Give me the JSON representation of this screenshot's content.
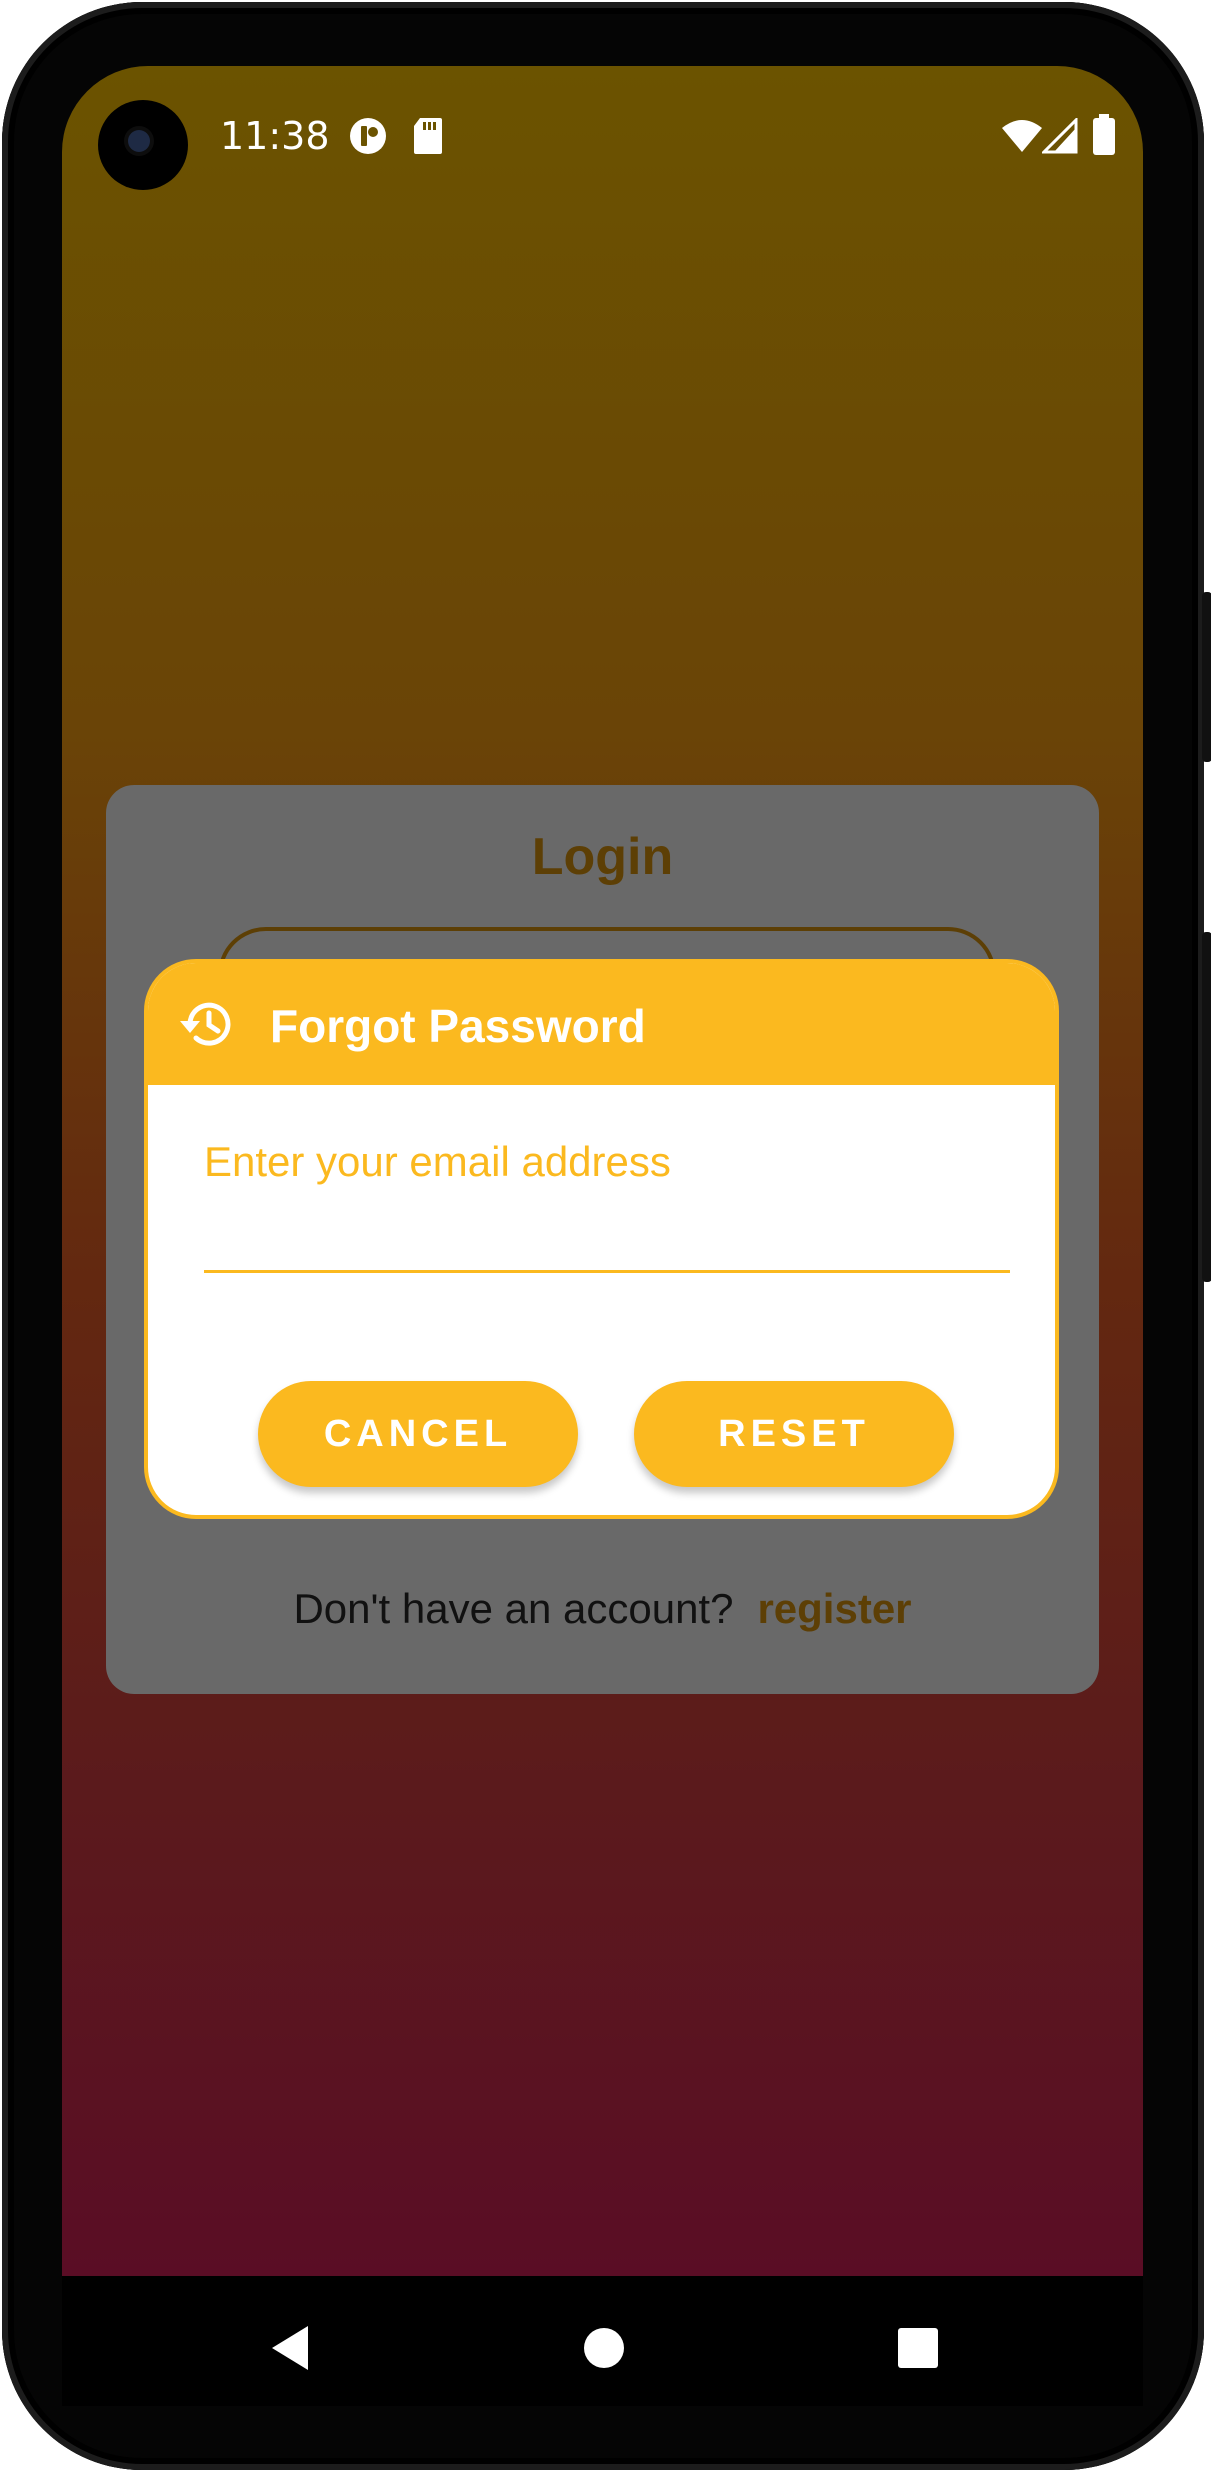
{
  "status_bar": {
    "time": "11:38",
    "left_icons": [
      "notification-icon",
      "sd-card-icon"
    ],
    "right_icons": [
      "wifi-icon",
      "cell-signal-icon",
      "battery-icon"
    ]
  },
  "login": {
    "title": "Login",
    "register_prompt": "Don't have an account?",
    "register_link": "register"
  },
  "dialog": {
    "title": "Forgot Password",
    "header_icon": "history-icon",
    "email_placeholder": "Enter your email address",
    "email_value": "",
    "cancel_label": "CANCEL",
    "reset_label": "RESET"
  },
  "nav_bar": {
    "buttons": [
      "back-icon",
      "home-icon",
      "recents-icon"
    ]
  },
  "colors": {
    "accent": "#fbb91f",
    "card_overlay": "#696969",
    "brown_text": "#5d3f05",
    "gradient_top": "#6b5300",
    "gradient_bottom": "#5a0d25"
  }
}
